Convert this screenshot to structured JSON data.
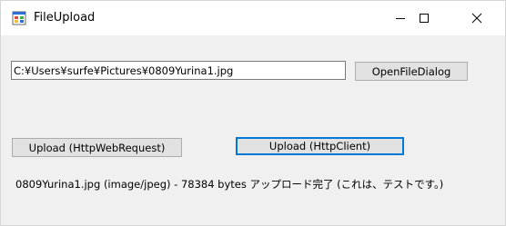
{
  "window": {
    "title": "FileUpload",
    "icons": {
      "app": "windows-form-icon",
      "minimize": "minimize-icon",
      "maximize": "maximize-icon",
      "close": "close-icon"
    }
  },
  "file_path": {
    "value": "C:¥Users¥surfe¥Pictures¥0809Yurina1.jpg"
  },
  "buttons": {
    "open_file_dialog": "OpenFileDialog",
    "upload_webrequest": "Upload (HttpWebRequest)",
    "upload_httpclient": "Upload (HttpClient)"
  },
  "status": {
    "text": "0809Yurina1.jpg (image/jpeg) - 78384 bytes アップロード完了 (これは、テストです。)"
  },
  "colors": {
    "focus_border": "#0078d7",
    "window_bg": "#f0f0f0",
    "button_bg": "#e1e1e1"
  }
}
